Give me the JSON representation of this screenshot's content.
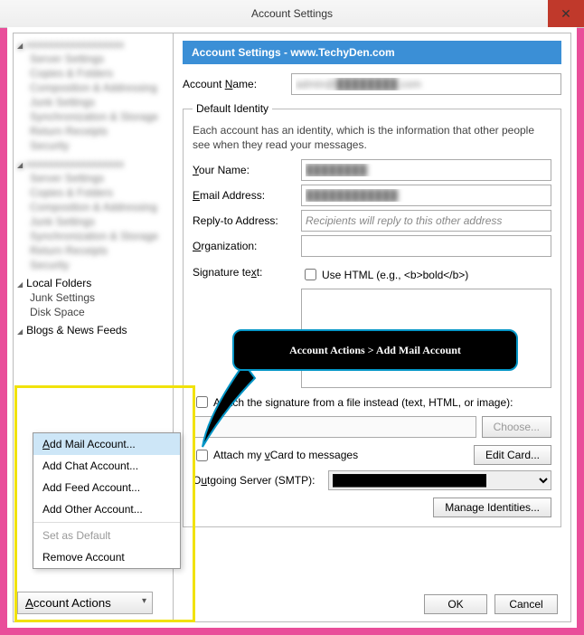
{
  "title": "Account Settings",
  "banner_prefix": "Account Settings - ",
  "banner_site": "www.TechyDen.com",
  "account_name_label": "Account Name:",
  "account_name_value": "admin@████████.com",
  "identity": {
    "legend": "Default Identity",
    "desc": "Each account has an identity, which is the information that other people see when they read your messages.",
    "your_name_label": "Your Name:",
    "your_name_value": "████████",
    "email_label": "Email Address:",
    "email_value": "████████████",
    "reply_label": "Reply-to Address:",
    "reply_placeholder": "Recipients will reply to this other address",
    "org_label": "Organization:",
    "sig_label": "Signature text:",
    "use_html_label": "Use HTML (e.g., <b>bold</b>)",
    "attach_sig_label": "Attach the signature from a file instead (text, HTML, or image):",
    "choose": "Choose...",
    "vcard_label": "Attach my vCard to messages",
    "edit_card": "Edit Card...",
    "smtp_label": "Outgoing Server (SMTP):",
    "smtp_value": "████████████████████",
    "manage": "Manage Identities..."
  },
  "footer": {
    "ok": "OK",
    "cancel": "Cancel"
  },
  "sidebar": {
    "local_folders": "Local Folders",
    "junk": "Junk Settings",
    "disk": "Disk Space",
    "blogs": "Blogs & News Feeds",
    "actions_btn": "Account Actions"
  },
  "menu": {
    "add_mail": "Add Mail Account...",
    "add_chat": "Add Chat Account...",
    "add_feed": "Add Feed Account...",
    "add_other": "Add Other Account...",
    "set_default": "Set as Default",
    "remove": "Remove Account"
  },
  "callout": "Account Actions > Add Mail Account"
}
